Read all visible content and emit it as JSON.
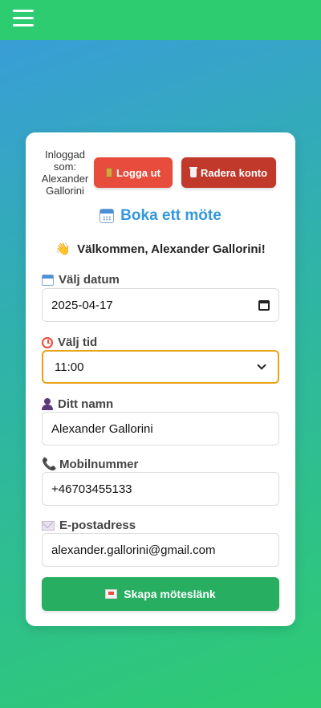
{
  "header": {
    "menu_icon": "hamburger-menu-icon",
    "color": "#2ecc71"
  },
  "account": {
    "logged_in_text": "Inloggad som: Alexander Gallorini",
    "logout_label": "Logga ut",
    "logout_icon": "door-icon",
    "delete_label": "Radera konto",
    "delete_icon": "trash-icon"
  },
  "form": {
    "title": "Boka ett möte",
    "title_icon": "calendar-icon",
    "welcome": "Välkommen, Alexander Gallorini!",
    "welcome_icon": "👋",
    "date": {
      "label": "Välj datum",
      "icon": "calendar-icon",
      "value": "2025-04-17"
    },
    "time": {
      "label": "Välj tid",
      "icon": "alarm-clock-icon",
      "value": "11:00"
    },
    "name": {
      "label": "Ditt namn",
      "icon": "person-icon",
      "value": "Alexander Gallorini"
    },
    "phone": {
      "label": "Mobilnummer",
      "icon": "phone-icon",
      "glyph": "📞",
      "value": "+46703455133"
    },
    "email": {
      "label": "E-postadress",
      "icon": "envelope-icon",
      "value": "alexander.gallorini@gmail.com"
    },
    "submit_label": "Skapa möteslänk",
    "submit_icon": "envelope-icon"
  },
  "colors": {
    "danger": "#e74c3c",
    "danger_dark": "#c0392b",
    "primary": "#3498db",
    "success": "#27ae60",
    "focus": "#e8a317"
  }
}
